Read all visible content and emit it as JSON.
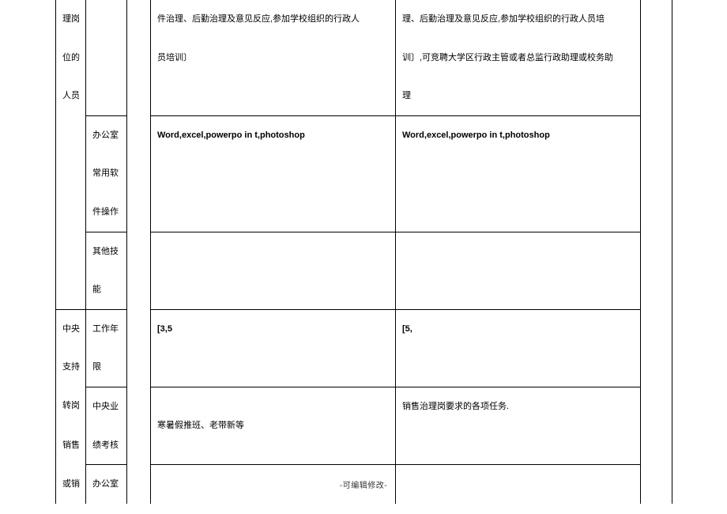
{
  "rows": {
    "r1": {
      "c1": "理岗",
      "c4": "件治理、后勤治理及意见反应,参加学校组织的行政人",
      "c5": "理、后勤治理及意见反应,参加学校组织的行政人员培"
    },
    "r2": {
      "c1": "位的",
      "c4": "员培训〕",
      "c5": "训〕,可竞聘大学区行政主管或者总监行政助理或校务助"
    },
    "r3": {
      "c1": "人员",
      "c5": "理"
    },
    "r4": {
      "c2": "办公室",
      "c4": "Word,excel,powerpo in t,photoshop",
      "c5": "Word,excel,powerpo in t,photoshop"
    },
    "r5": {
      "c2": "常用软"
    },
    "r6": {
      "c2": "件操作"
    },
    "r7": {
      "c2": "其他技"
    },
    "r8": {
      "c2": "能"
    },
    "r9": {
      "c1": "中央",
      "c2": "工作年",
      "c4": "[3,5",
      "c5": "[5,"
    },
    "r10": {
      "c1": "支持",
      "c2": "限"
    },
    "r11": {
      "c1": "转岗",
      "c2": "中央业",
      "c4": "寒暑假推班、老带新等",
      "c5": "销售治理岗要求的各项任务."
    },
    "r12": {
      "c1": "销售",
      "c2": "绩考核"
    },
    "r13": {
      "c1": "或销",
      "c2": "办公室"
    }
  },
  "footer": "-可编辑修改-"
}
